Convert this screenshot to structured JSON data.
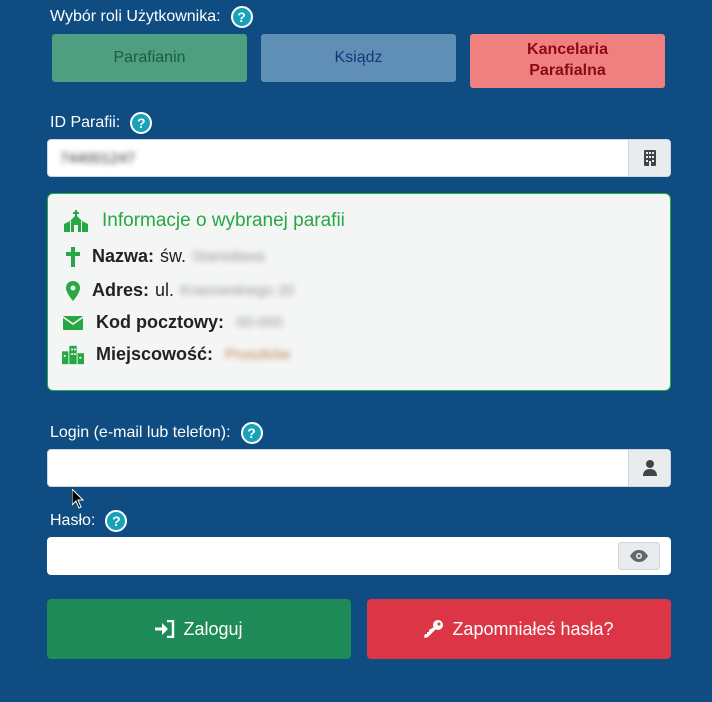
{
  "role_section": {
    "label": "Wybór roli Użytkownika:",
    "help": "?",
    "roles": [
      "Parafianin",
      "Ksiądz",
      "Kancelaria Parafialna"
    ]
  },
  "parish_id": {
    "label": "ID Parafii:",
    "help": "?",
    "value": "744001247",
    "icon": "building-icon"
  },
  "info": {
    "title": "Informacje o wybranej parafii",
    "name_label": "Nazwa:",
    "name_prefix": "św.",
    "name_value": "Stanisława",
    "address_label": "Adres:",
    "address_prefix": "ul.",
    "address_value": "Krasowskiego 20",
    "postal_label": "Kod pocztowy:",
    "postal_value": "00-000",
    "city_label": "Miejscowość:",
    "city_value": "Pruszków"
  },
  "login": {
    "label": "Login (e-mail lub telefon):",
    "help": "?",
    "value": "",
    "icon": "user-icon"
  },
  "password": {
    "label": "Hasło:",
    "help": "?",
    "value": "",
    "icon": "eye-icon"
  },
  "buttons": {
    "login": "Zaloguj",
    "forgot": "Zapomniałeś hasła?"
  },
  "colors": {
    "background": "#0f4c81",
    "green": "#28a745",
    "red": "#dc3545"
  }
}
